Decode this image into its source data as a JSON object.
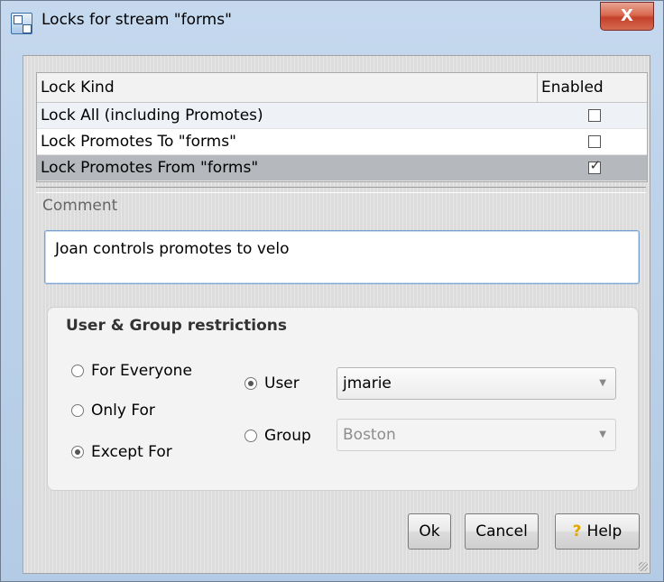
{
  "window": {
    "title": "Locks for stream \"forms\"",
    "close_label": "X"
  },
  "table": {
    "headers": {
      "kind": "Lock Kind",
      "enabled": "Enabled"
    },
    "rows": [
      {
        "kind": "Lock All (including Promotes)",
        "enabled": false
      },
      {
        "kind": "Lock Promotes To \"forms\"",
        "enabled": false
      },
      {
        "kind": "Lock Promotes From \"forms\"",
        "enabled": true
      }
    ]
  },
  "comment": {
    "label": "Comment",
    "value": "Joan controls promotes to velo"
  },
  "restrictions": {
    "title": "User & Group restrictions",
    "scope_options": [
      {
        "label": "For Everyone",
        "selected": false
      },
      {
        "label": "Only For",
        "selected": false
      },
      {
        "label": "Except For",
        "selected": true
      }
    ],
    "user": {
      "label": "User",
      "selected": true,
      "value": "jmarie"
    },
    "group": {
      "label": "Group",
      "selected": false,
      "value": "Boston"
    }
  },
  "buttons": {
    "ok": "Ok",
    "cancel": "Cancel",
    "help": "Help"
  }
}
